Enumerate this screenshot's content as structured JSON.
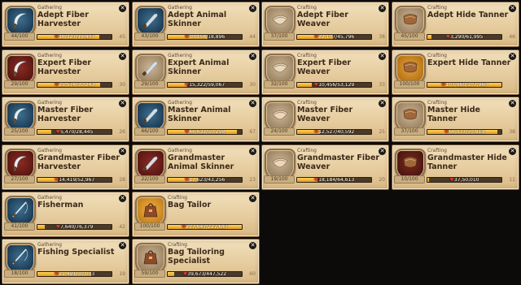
{
  "colors": {
    "panel": "#e6cc9e",
    "text": "#3b2a1a",
    "xp_bar": "#ffd35a",
    "heart": "#e23a2a"
  },
  "cards": [
    {
      "category": "Gathering",
      "title": "Adept Fiber Harvester",
      "level": "44/100",
      "xp": "16,327/19,407",
      "next": "45",
      "progress": 0.84,
      "badge": "t4",
      "icon": "sickle-icon"
    },
    {
      "category": "Gathering",
      "title": "Adept Animal Skinner",
      "level": "43/100",
      "xp": "10,158/18,896",
      "next": "44",
      "progress": 0.54,
      "badge": "t4",
      "icon": "skinning-knife-icon"
    },
    {
      "category": "Crafting",
      "title": "Adept Fiber Weaver",
      "level": "37/100",
      "xp": "22,107/45,796",
      "next": "38",
      "progress": 0.48,
      "badge": "craft",
      "icon": "cloth-icon"
    },
    {
      "category": "Crafting",
      "title": "Adept Hide Tanner",
      "level": "45/100",
      "xp": "3,290/61,995",
      "next": "46",
      "progress": 0.05,
      "badge": "craft",
      "icon": "leather-icon"
    },
    {
      "category": "Gathering",
      "title": "Expert Fiber Harvester",
      "level": "29/100",
      "xp": "25,574/30,243",
      "next": "30",
      "progress": 0.85,
      "badge": "t8",
      "icon": "sickle-icon"
    },
    {
      "category": "Gathering",
      "title": "Expert Animal Skinner",
      "level": "29/100",
      "xp": "15,322/59,067",
      "next": "30",
      "progress": 0.26,
      "badge": "craft",
      "icon": "skinning-knife-icon"
    },
    {
      "category": "Crafting",
      "title": "Expert Fiber Weaver",
      "level": "32/100",
      "xp": "10,456/53,129",
      "next": "33",
      "progress": 0.2,
      "badge": "craft",
      "icon": "cloth-icon"
    },
    {
      "category": "Crafting",
      "title": "Expert Hide Tanner",
      "level": "100/100",
      "xp": "107,960/107,960",
      "next": "",
      "progress": 1.0,
      "badge": "gold",
      "icon": "leather-icon"
    },
    {
      "category": "Gathering",
      "title": "Master Fiber Harvester",
      "level": "25/100",
      "xp": "5,470/28,445",
      "next": "26",
      "progress": 0.19,
      "badge": "t4",
      "icon": "sickle-icon"
    },
    {
      "category": "Gathering",
      "title": "Master Animal Skinner",
      "level": "66/100",
      "xp": "46,632/50,298",
      "next": "67",
      "progress": 0.93,
      "badge": "t4",
      "icon": "skinning-knife-icon"
    },
    {
      "category": "Crafting",
      "title": "Master Fiber Weaver",
      "level": "24/100",
      "xp": "12,527/40,592",
      "next": "25",
      "progress": 0.31,
      "badge": "craft",
      "icon": "cloth-icon"
    },
    {
      "category": "Crafting",
      "title": "Master Hide Tanner",
      "level": "37/100",
      "xp": "66,377/70,819",
      "next": "38",
      "progress": 0.94,
      "badge": "craft",
      "icon": "leather-icon"
    },
    {
      "category": "Gathering",
      "title": "Grandmaster Fiber Harvester",
      "level": "27/100",
      "xp": "14,419/52,967",
      "next": "28",
      "progress": 0.27,
      "badge": "t8",
      "icon": "sickle-icon"
    },
    {
      "category": "Gathering",
      "title": "Grandmaster Animal Skinner",
      "level": "22/100",
      "xp": "17,623/43,256",
      "next": "23",
      "progress": 0.41,
      "badge": "t8",
      "icon": "skinning-knife-icon"
    },
    {
      "category": "Crafting",
      "title": "Grandmaster Fiber Weaver",
      "level": "19/100",
      "xp": "18,184/64,613",
      "next": "20",
      "progress": 0.28,
      "badge": "craft",
      "icon": "cloth-icon"
    },
    {
      "category": "Crafting",
      "title": "Grandmaster Hide Tanner",
      "level": "10/100",
      "xp": "37,50,010",
      "next": "11",
      "progress": 0.02,
      "badge": "dark",
      "icon": "leather-icon"
    },
    {
      "category": "Gathering",
      "title": "Fisherman",
      "level": "41/100",
      "xp": "7,640/76,379",
      "next": "42",
      "progress": 0.1,
      "badge": "t4",
      "icon": "fishing-rod-icon"
    },
    {
      "category": "Crafting",
      "title": "Bag Tailor",
      "level": "100/100",
      "xp": "227,647/227,647",
      "next": "",
      "progress": 1.0,
      "badge": "gold2",
      "icon": "bag-icon"
    },
    null,
    null,
    {
      "category": "Gathering",
      "title": "Fishing Specialist",
      "level": "18/100",
      "xp": "21,491/30,003",
      "next": "19",
      "progress": 0.72,
      "badge": "t4",
      "icon": "fishing-rod-icon"
    },
    {
      "category": "Crafting",
      "title": "Bag Tailoring Specialist",
      "level": "59/100",
      "xp": "39,673/447,522",
      "next": "60",
      "progress": 0.09,
      "badge": "craft",
      "icon": "bag-icon"
    }
  ]
}
